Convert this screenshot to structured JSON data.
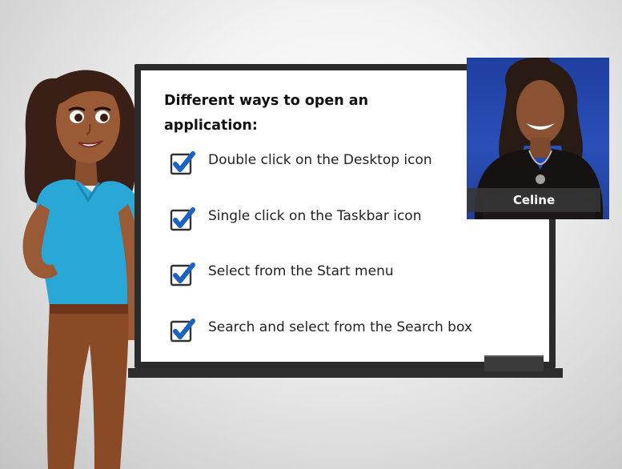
{
  "board": {
    "heading": "Different ways to open an application:",
    "items": [
      {
        "text": "Double click on the Desktop icon",
        "checked": true
      },
      {
        "text": "Single click on the Taskbar icon",
        "checked": true
      },
      {
        "text": "Select from the Start menu",
        "checked": true
      },
      {
        "text": "Search and select from the Search box",
        "checked": true
      }
    ]
  },
  "presenter": {
    "name": "Celine"
  },
  "colors": {
    "checkbox_blue": "#1e62c0",
    "photo_background": "#2a4fb8",
    "character_shirt": "#29a8d8"
  }
}
